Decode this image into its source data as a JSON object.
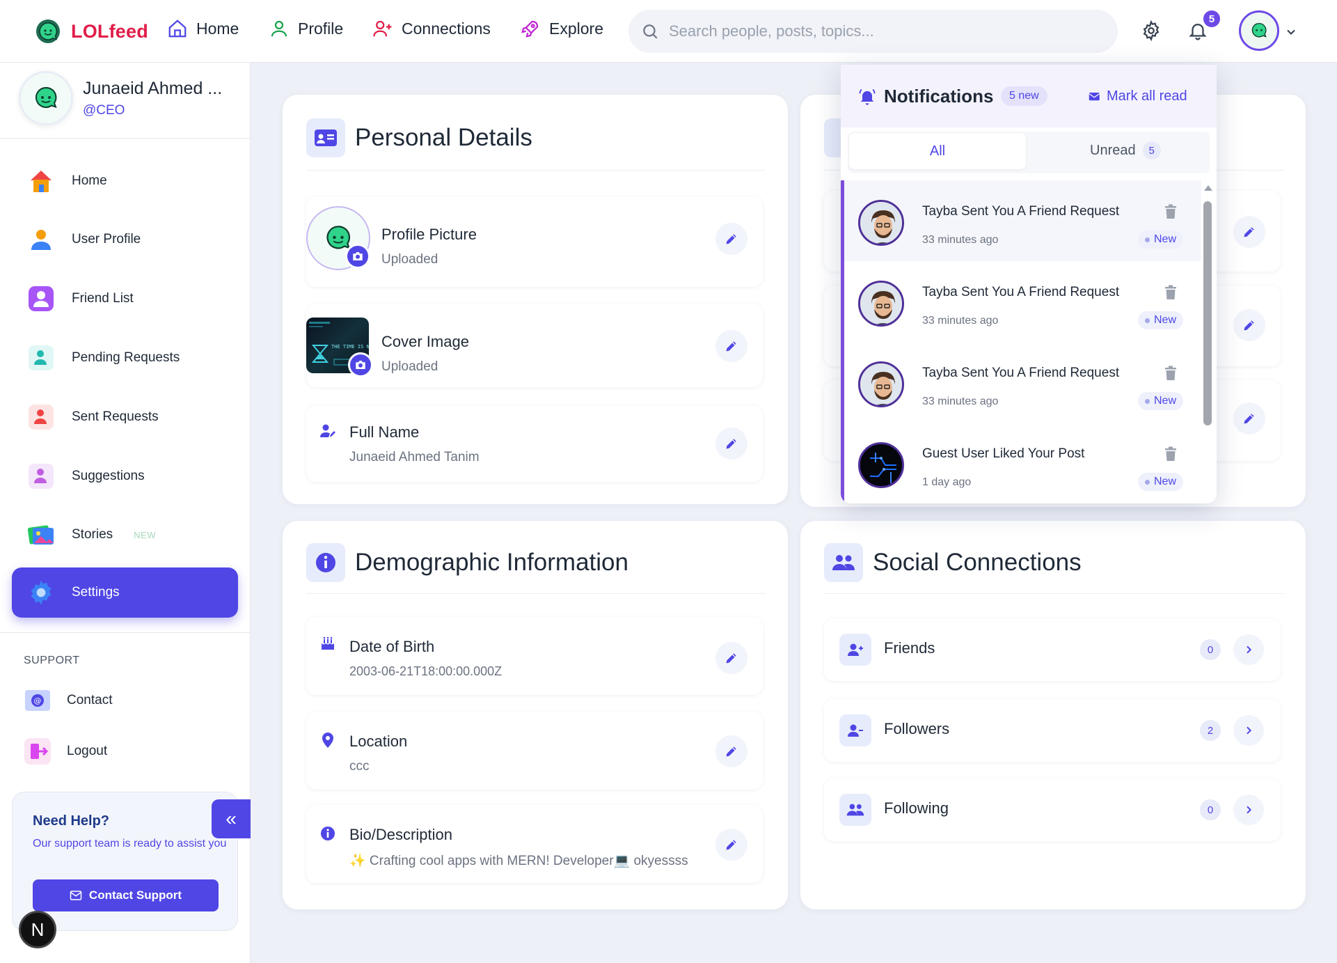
{
  "nav": {
    "brand": "LOLfeed",
    "links": [
      "Home",
      "Profile",
      "Connections",
      "Explore"
    ],
    "search_placeholder": "Search people, posts, topics...",
    "notification_count": "5"
  },
  "sidebar": {
    "user_name": "Junaeid Ahmed ...",
    "user_handle": "@CEO",
    "items": [
      {
        "label": "Home"
      },
      {
        "label": "User Profile"
      },
      {
        "label": "Friend List"
      },
      {
        "label": "Pending Requests"
      },
      {
        "label": "Sent Requests"
      },
      {
        "label": "Suggestions"
      },
      {
        "label": "Stories",
        "tag": "NEW"
      },
      {
        "label": "Settings"
      }
    ],
    "support_label": "SUPPORT",
    "support_items": [
      {
        "label": "Contact"
      },
      {
        "label": "Logout"
      }
    ],
    "help": {
      "title": "Need Help?",
      "subtitle": "Our support team is ready to assist you",
      "button": "Contact Support"
    },
    "dev_badge": "N"
  },
  "personal": {
    "title": "Personal Details",
    "profile_picture": {
      "label": "Profile Picture",
      "value": "Uploaded"
    },
    "cover_image": {
      "label": "Cover Image",
      "value": "Uploaded"
    },
    "full_name": {
      "label": "Full Name",
      "value": "Junaeid Ahmed Tanim"
    }
  },
  "demographic": {
    "title": "Demographic Information",
    "dob": {
      "label": "Date of Birth",
      "value": "2003-06-21T18:00:00.000Z"
    },
    "location": {
      "label": "Location",
      "value": "ccc"
    },
    "bio": {
      "label": "Bio/Description",
      "value": "✨ Crafting cool apps with MERN! Developer💻 okyessss"
    }
  },
  "social": {
    "title": "Social Connections",
    "items": [
      {
        "label": "Friends",
        "count": "0"
      },
      {
        "label": "Followers",
        "count": "2"
      },
      {
        "label": "Following",
        "count": "0"
      }
    ]
  },
  "notifications": {
    "title": "Notifications",
    "new_count": "5 new",
    "mark_all": "Mark all read",
    "tab_all": "All",
    "tab_unread": "Unread",
    "unread_count": "5",
    "new_label": "New",
    "items": [
      {
        "title": "Tayba Sent You A Friend Request",
        "time": "33 minutes ago"
      },
      {
        "title": "Tayba Sent You A Friend Request",
        "time": "33 minutes ago"
      },
      {
        "title": "Tayba Sent You A Friend Request",
        "time": "33 minutes ago"
      },
      {
        "title": "Guest User Liked Your Post",
        "time": "1 day ago"
      }
    ]
  },
  "colors": {
    "accent": "#4f46e5",
    "brand": "#e11d48",
    "notification_bar": "#7c4ddb"
  }
}
